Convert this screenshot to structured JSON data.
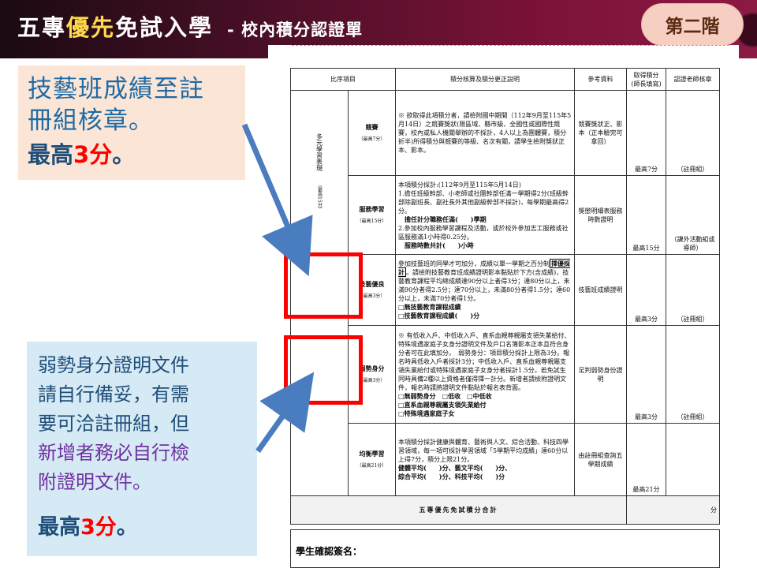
{
  "header": {
    "title_part1": "五專",
    "title_highlight": "優先",
    "title_part2": "免試入學",
    "subtitle": "- 校內積分認證單",
    "stage_badge": "第二階"
  },
  "callout_top": {
    "line1": "技藝班成績至註",
    "line2": "冊組核章。",
    "max_prefix": "最高",
    "max_value": "3分",
    "max_suffix": "。"
  },
  "callout_bottom": {
    "lines": [
      "弱勢身分證明文件",
      "請自行備妥，有需",
      "要可洽註冊組，但"
    ],
    "purple_lines": [
      "新增者務必自行檢",
      "附證明文件。"
    ],
    "max_prefix": "最高",
    "max_value": "3分",
    "max_suffix": "。"
  },
  "form": {
    "headers": {
      "category": "比序項目",
      "description": "積分核算及積分更正說明",
      "reference": "參考資料",
      "score": "取得積分(師長填寫)",
      "signer": "認證老師核章"
    },
    "category_main": "多元學習表現",
    "category_note": "（最高15分）",
    "rows": {
      "competition": {
        "name": "競賽",
        "max": "（最高7分）",
        "desc": "※ 欲取得此項積分者，請檢附國中期間（112年9月至115年5月14日）之競賽獎狀(限區域、縣市級、全國性或國際性競賽，校內或私人機關舉辦的不採計，4人以上為團體賽，積分折半)所得積分與競賽的等級、名次有關，請學生檢附獎狀正本、影本。",
        "ref": "競賽獎狀正、影本（正本驗完可拿回）",
        "score": "最高7分",
        "signer": "（註冊組）"
      },
      "service": {
        "name": "服務學習",
        "max": "（最高15分）",
        "desc1": "本項積分採計:(112年9月至115年5月14日)",
        "desc2": "1.擔任班級幹部、小老師或社團幹部任滿一學期得2分(班級幹部除副班長、副社長外其他副級幹部不採計)，每學期最高得2分。",
        "desc3": "擔任計分職務任滿(　　)學期",
        "desc4": "2.參加校內服務學習課程及活動，或於校外參加志工服務或社區服務滿1小時得0.25分。",
        "desc5": "服務時數共計(　　)小時",
        "ref": "獎懲明細表服務時數證明",
        "score": "最高15分",
        "signer": "（課外活動組或導師）"
      },
      "skill": {
        "name": "技藝優良",
        "max": "（最高3分）",
        "desc1": "參加技藝班的同學才可加分，成績以單一學期之百分制",
        "desc_boxed": "擇優採計",
        "desc2": "。請檢附技藝教育班成績證明影本黏貼於下方(含成績)，技藝教育課程平均總成績達90分以上者得3分；達80分以上，未滿90分者得2.5分；達70分以上，未滿80分者得1.5分；達60分以上，未滿70分者得1分。",
        "check1": "□無技藝教育課程成績",
        "check2": "□技藝教育課程成績(　　)分",
        "ref": "技藝班成績證明",
        "score": "最高3分",
        "signer": "（註冊組）"
      },
      "disadvantaged": {
        "name": "弱勢身分",
        "max": "（最高3分）",
        "desc": "※ 有低收入戶、中低收入戶、直系血親尊親屬支領失業給付、特殊境遇家庭子女身分證明文件及戶口名簿影本正本且符合身分者可在此填加分。　弱勢身分：項目積分採計上限為3分。報名時具低收入戶者採計3分；中低收入戶、直系血親尊親屬支領失業給付或特殊境遇家庭子女身分者採計1.5分。若免試生同時具備2種以上資格者僅得擇一計分。新增者請檢附證明文件，報名時請將證明文件黏貼於報名表背面。",
        "check1": "□無弱勢身分　□低收　□中低收",
        "check2": "□直系血親尊親屬支領失業給付",
        "check3": "□特殊境遇家庭子女",
        "ref": "足判弱勢身份證明",
        "score": "最高3分",
        "signer": "（註冊組）"
      },
      "balanced": {
        "name": "均衡學習",
        "max": "（最高21分）",
        "desc1": "本項積分採計健康與體育、藝術與人文、綜合活動、科技四學習領域，每一項可採計學習領域「5學期平均成績」達60分以上得7分，積分上限21分。",
        "desc2": "健體平均(　　)分、藝文平均(　　)分、",
        "desc3": "綜合平均(　　)分、科技平均(　　)分",
        "ref": "由註冊組查詢五學期成績",
        "score": "最高21分",
        "signer": ""
      }
    },
    "total_label": "五專優先免試積分合計",
    "total_unit": "分",
    "signature_label": "學生確認簽名："
  },
  "colors": {
    "accent_red": "#ff0000",
    "header_bg": "#4a0f28",
    "badge_bg": "#f7cfc2",
    "callout_top_bg": "#fbe5d6",
    "callout_bottom_bg": "#d6eaf5",
    "arrow": "#4a7dc0"
  }
}
